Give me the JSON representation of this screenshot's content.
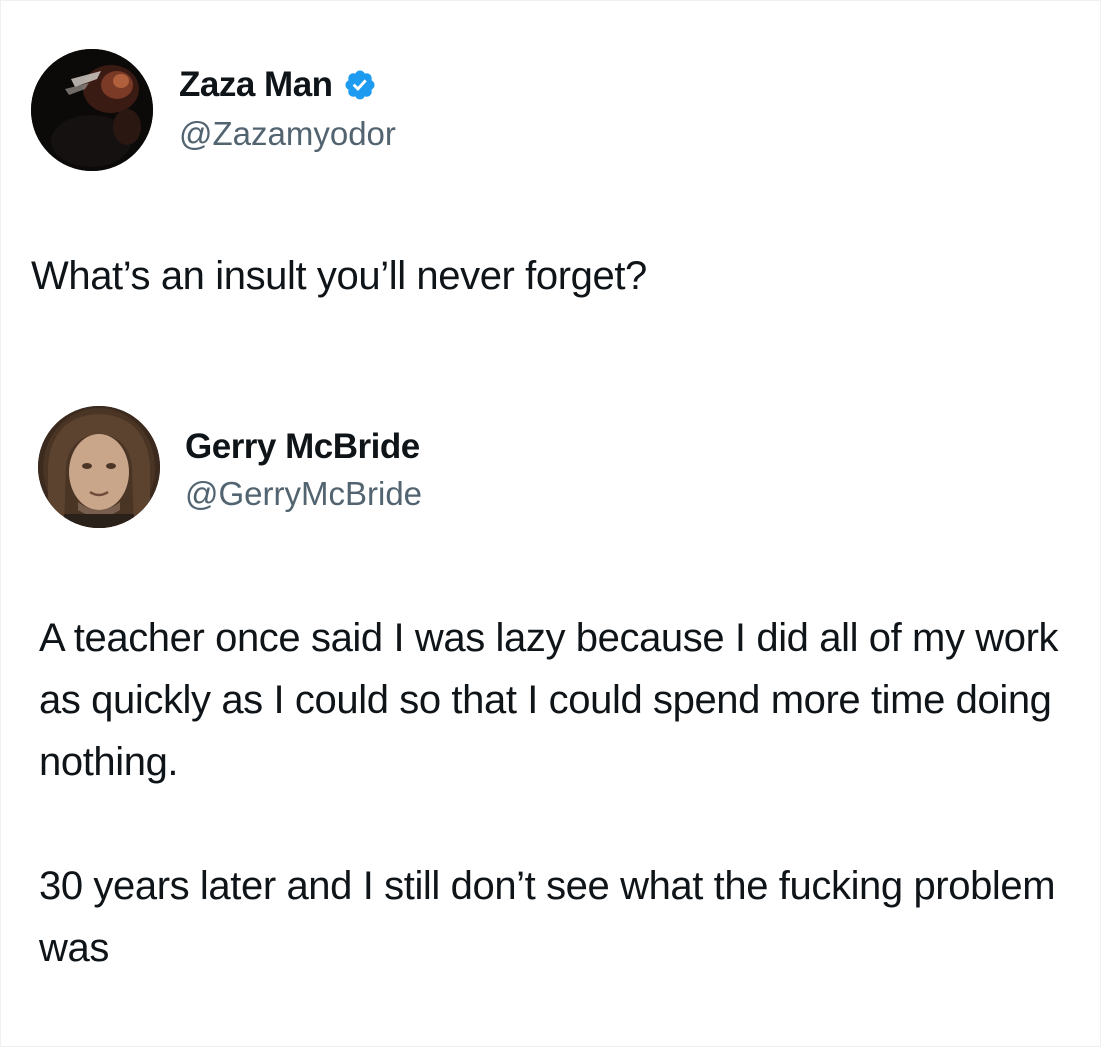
{
  "tweets": [
    {
      "display_name": "Zaza Man",
      "handle": "@Zazamyodor",
      "verified": true,
      "text": "What’s an insult you’ll never forget?"
    },
    {
      "display_name": "Gerry McBride",
      "handle": "@GerryMcBride",
      "verified": false,
      "paragraphs": [
        "A teacher once said I was lazy because I did all of my work as quickly as I could so that I could spend more time doing nothing.",
        "30 years later and I still don’t see what the fucking problem was"
      ]
    }
  ],
  "colors": {
    "text": "#0f1419",
    "handle": "#536471",
    "verified_blue": "#1d9bf0",
    "background": "#ffffff"
  },
  "icons": {
    "verified": "verified-badge-icon"
  }
}
